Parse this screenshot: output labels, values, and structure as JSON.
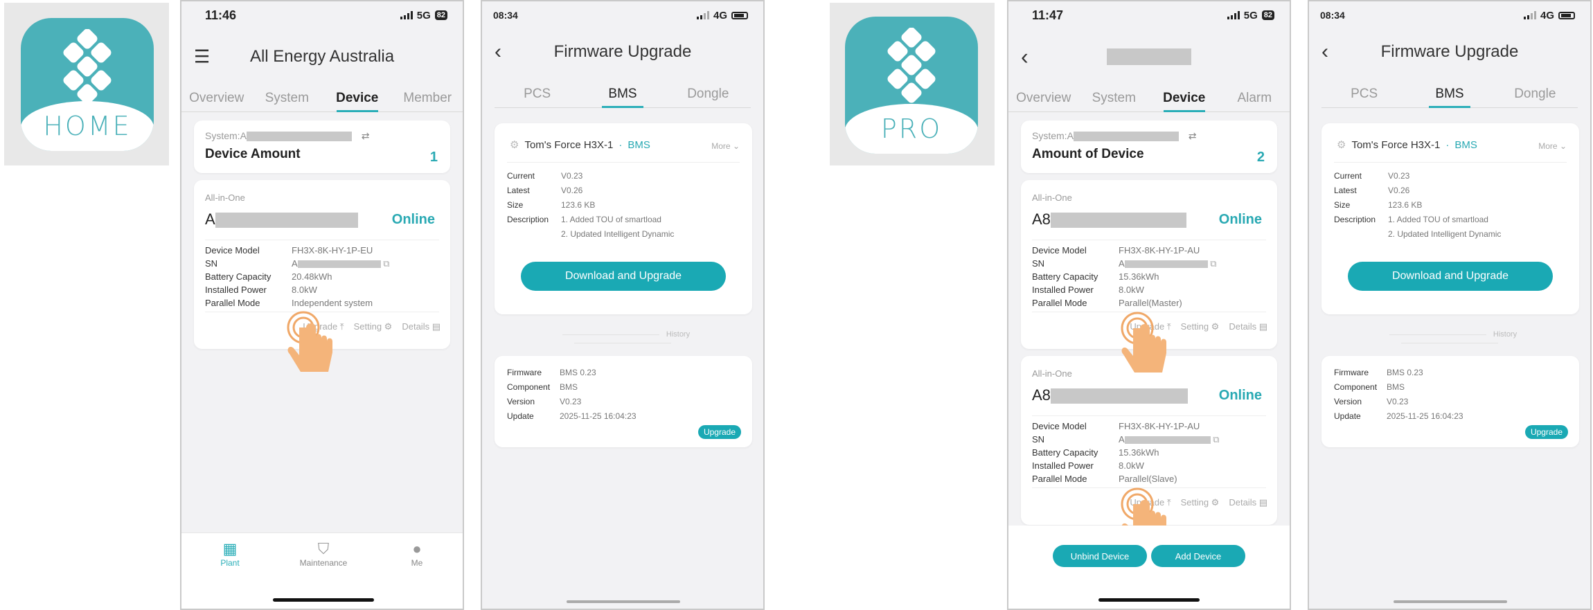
{
  "colors": {
    "accent": "#1aa9b4",
    "logo": "#4bb1b9"
  },
  "logos": [
    {
      "text": "HOME"
    },
    {
      "text": "PRO"
    }
  ],
  "home": {
    "time": "11:46",
    "network": "5G",
    "battery": "82",
    "title": "All Energy Australia",
    "tabs": [
      "Overview",
      "System",
      "Device",
      "Member"
    ],
    "system_label": "System:A",
    "amount_label": "Device Amount",
    "amount_value": "1",
    "device": {
      "type": "All-in-One",
      "name": "A",
      "status": "Online",
      "rows": [
        [
          "Device Model",
          "FH3X-8K-HY-1P-EU"
        ],
        [
          "SN",
          "A"
        ],
        [
          "Battery Capacity",
          "20.48kWh"
        ],
        [
          "Installed Power",
          "8.0kW"
        ],
        [
          "Parallel Mode",
          "Independent system"
        ]
      ]
    },
    "actions": [
      "Upgrade",
      "Setting",
      "Details"
    ],
    "nav": [
      "Plant",
      "Maintenance",
      "Me"
    ]
  },
  "fw1": {
    "time": "08:34",
    "network": "4G",
    "title": "Firmware Upgrade",
    "tabs": [
      "PCS",
      "BMS",
      "Dongle"
    ],
    "device_name": "Tom's Force H3X-1",
    "device_tag": "BMS",
    "more": "More",
    "rows": [
      [
        "Current",
        "V0.23"
      ],
      [
        "Latest",
        "V0.26"
      ],
      [
        "Size",
        "123.6 KB"
      ],
      [
        "Description",
        "1. Added TOU of smartload"
      ],
      [
        "",
        "2. Updated Intelligent Dynamic"
      ]
    ],
    "download_button": "Download and Upgrade",
    "history_label": "History",
    "history": [
      [
        "Firmware",
        "BMS 0.23"
      ],
      [
        "Component",
        "BMS"
      ],
      [
        "Version",
        "V0.23"
      ],
      [
        "Update",
        "2025-11-25 16:04:23"
      ]
    ],
    "history_badge": "Upgrade"
  },
  "pro": {
    "time": "11:47",
    "network": "5G",
    "battery": "82",
    "tabs": [
      "Overview",
      "System",
      "Device",
      "Alarm"
    ],
    "system_label": "System:A",
    "amount_label": "Amount of Device",
    "amount_value": "2",
    "devices": [
      {
        "type": "All-in-One",
        "name": "A8",
        "status": "Online",
        "rows": [
          [
            "Device Model",
            "FH3X-8K-HY-1P-AU"
          ],
          [
            "SN",
            "A"
          ],
          [
            "Battery Capacity",
            "15.36kWh"
          ],
          [
            "Installed Power",
            "8.0kW"
          ],
          [
            "Parallel Mode",
            "Parallel(Master)"
          ]
        ]
      },
      {
        "type": "All-in-One",
        "name": "A8",
        "status": "Online",
        "rows": [
          [
            "Device Model",
            "FH3X-8K-HY-1P-AU"
          ],
          [
            "SN",
            "A"
          ],
          [
            "Battery Capacity",
            "15.36kWh"
          ],
          [
            "Installed Power",
            "8.0kW"
          ],
          [
            "Parallel Mode",
            "Parallel(Slave)"
          ]
        ]
      }
    ],
    "actions": [
      "Upgrade",
      "Setting",
      "Details"
    ],
    "unbind_button": "Unbind Device",
    "add_button": "Add Device"
  },
  "fw2": {
    "time": "08:34",
    "network": "4G",
    "title": "Firmware Upgrade",
    "tabs": [
      "PCS",
      "BMS",
      "Dongle"
    ],
    "device_name": "Tom's Force H3X-1",
    "device_tag": "BMS",
    "more": "More",
    "rows": [
      [
        "Current",
        "V0.23"
      ],
      [
        "Latest",
        "V0.26"
      ],
      [
        "Size",
        "123.6 KB"
      ],
      [
        "Description",
        "1. Added TOU of smartload"
      ],
      [
        "",
        "2. Updated Intelligent Dynamic"
      ]
    ],
    "download_button": "Download and Upgrade",
    "history_label": "History",
    "history": [
      [
        "Firmware",
        "BMS 0.23"
      ],
      [
        "Component",
        "BMS"
      ],
      [
        "Version",
        "V0.23"
      ],
      [
        "Update",
        "2025-11-25 16:04:23"
      ]
    ],
    "history_badge": "Upgrade"
  }
}
